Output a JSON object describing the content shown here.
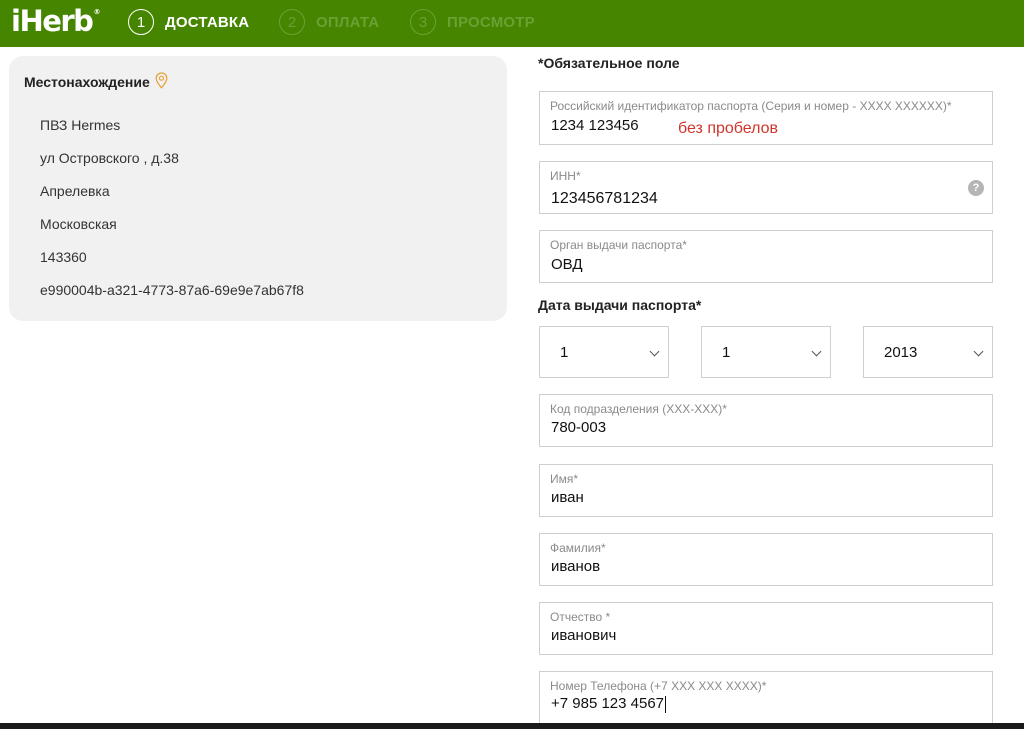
{
  "header": {
    "logo": "iHerb",
    "logo_mark": "®",
    "steps": [
      {
        "number": "1",
        "label": "ДОСТАВКА"
      },
      {
        "number": "2",
        "label": "ОПЛАТА"
      },
      {
        "number": "3",
        "label": "ПРОСМОТР"
      }
    ]
  },
  "location": {
    "title": "Местонахождение",
    "icon": "location-pin-icon",
    "lines": [
      "ПВЗ Hermes",
      "ул Островского , д.38",
      "Апрелевка",
      "Московская",
      "143360",
      "e990004b-a321-4773-87a6-69e9e7ab67f8"
    ]
  },
  "form": {
    "required_note": "*Обязательное поле",
    "passport_id": {
      "label": "Российский идентификатор паспорта (Серия и номер - XXXX XXXXXX)*",
      "value": "1234 123456",
      "hint": "без пробелов"
    },
    "inn": {
      "label": "ИНН*",
      "value": "123456781234",
      "help": "?"
    },
    "issuer": {
      "label": "Орган выдачи паспорта*",
      "value": "ОВД"
    },
    "issue_date": {
      "label": "Дата выдачи паспорта*",
      "day": "1",
      "month": "1",
      "year": "2013"
    },
    "division_code": {
      "label": "Код подразделения (XXX-XXX)*",
      "value": "780-003"
    },
    "first_name": {
      "label": "Имя*",
      "value": "иван"
    },
    "last_name": {
      "label": "Фамилия*",
      "value": "иванов"
    },
    "patronymic": {
      "label": "Отчество *",
      "value": "иванович"
    },
    "phone": {
      "label": "Номер Телефона (+7 XXX XXX XXXX)*",
      "value": "+7 985 123 4567"
    }
  },
  "colors": {
    "brand_green": "#458500",
    "hint_red": "#d0352c"
  }
}
